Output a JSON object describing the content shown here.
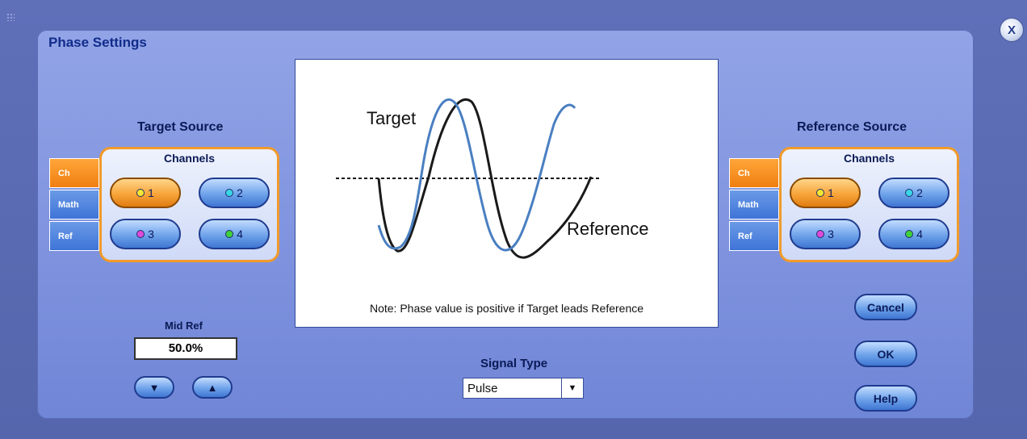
{
  "dialog": {
    "title": "Phase Settings"
  },
  "target_source": {
    "title": "Target Source",
    "tabs": [
      "Ch",
      "Math",
      "Ref"
    ],
    "active_tab": "Ch",
    "channels_label": "Channels",
    "channels": [
      "1",
      "2",
      "3",
      "4"
    ],
    "selected_channel": "1"
  },
  "reference_source": {
    "title": "Reference Source",
    "tabs": [
      "Ch",
      "Math",
      "Ref"
    ],
    "active_tab": "Ch",
    "channels_label": "Channels",
    "channels": [
      "1",
      "2",
      "3",
      "4"
    ],
    "selected_channel": "1"
  },
  "diagram": {
    "target_label": "Target",
    "reference_label": "Reference",
    "note": "Note: Phase value is positive if Target leads Reference"
  },
  "mid_ref": {
    "label": "Mid Ref",
    "value": "50.0%"
  },
  "signal_type": {
    "label": "Signal Type",
    "value": "Pulse"
  },
  "buttons": {
    "cancel": "Cancel",
    "ok": "OK",
    "help": "Help",
    "close": "X"
  },
  "colors": {
    "panel": "#8599e0",
    "accent_orange": "#f19a2a",
    "channel_1": "#f5e630",
    "channel_2": "#39d6e8",
    "channel_3": "#e04ad8",
    "channel_4": "#3fd13a",
    "target_wave": "#4a7fc1",
    "reference_wave": "#1a1a1a"
  }
}
